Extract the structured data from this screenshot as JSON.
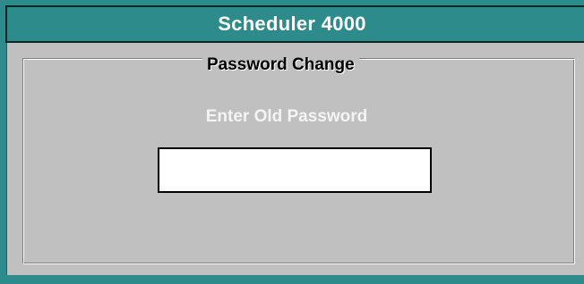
{
  "window": {
    "title": "Scheduler 4000",
    "accent_color": "#2e8b8b",
    "background_color": "#c0c0c0"
  },
  "group": {
    "label": "Password  Change"
  },
  "prompt": {
    "label": "Enter Old Password"
  },
  "password_field": {
    "value": "",
    "placeholder": ""
  }
}
